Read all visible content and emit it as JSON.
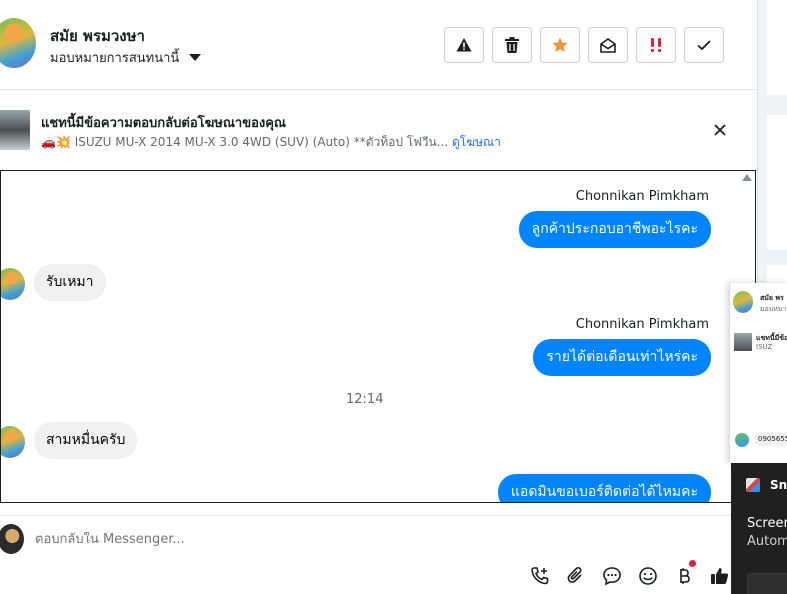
{
  "header": {
    "contact_name": "สมัย พรมวงษา",
    "assign_label": "มอบหมายการสนทนานี้",
    "toolbar": [
      {
        "icon": "warning-icon"
      },
      {
        "icon": "trash-icon"
      },
      {
        "icon": "star-icon",
        "color": "#f7923a"
      },
      {
        "icon": "mail-open-icon"
      },
      {
        "icon": "priority-icon",
        "color": "#e41e3f"
      },
      {
        "icon": "check-icon"
      }
    ]
  },
  "ad_banner": {
    "title": "แชทนี้มีข้อความตอบกลับต่อโฆษณาของคุณ",
    "subtitle": "ISUZU MU-X 2014 MU-X 3.0 4WD (SUV) (Auto) **ตัวท็อป โฟวีน...",
    "link": "ดูโฆษณา"
  },
  "messages": [
    {
      "type": "sender",
      "text": "Chonnikan Pimkham"
    },
    {
      "type": "outgoing",
      "text": "ลูกค้าประกอบอาชีพอะไรคะ"
    },
    {
      "type": "incoming",
      "text": "รับเหมา"
    },
    {
      "type": "sender",
      "text": "Chonnikan Pimkham"
    },
    {
      "type": "outgoing",
      "text": "รายได้ต่อเดือนเท่าไหร่คะ"
    },
    {
      "type": "time",
      "text": "12:14"
    },
    {
      "type": "incoming",
      "text": "สามหมื่นครับ"
    },
    {
      "type": "outgoing",
      "text": "แอดมินขอเบอร์ติดต่อได้ไหมคะ"
    }
  ],
  "composer": {
    "placeholder": "ตอบกลับใน Messenger...",
    "icons": [
      "call-add-icon",
      "attachment-icon",
      "saved-reply-icon",
      "emoji-icon",
      "payment-icon",
      "like-icon"
    ]
  },
  "preview": {
    "name": "สมัย พร",
    "sub": "มอบหมายก",
    "ad_line1": "แชทนี้มีข้อ",
    "ad_line2": "ISUZ",
    "bubble": "0905655"
  },
  "notification": {
    "app": "Sni",
    "title": "Screen",
    "body": "Autom"
  },
  "colors": {
    "accent": "#0084ff",
    "link": "#216fdb",
    "incoming_bubble": "#f0f0f0"
  }
}
